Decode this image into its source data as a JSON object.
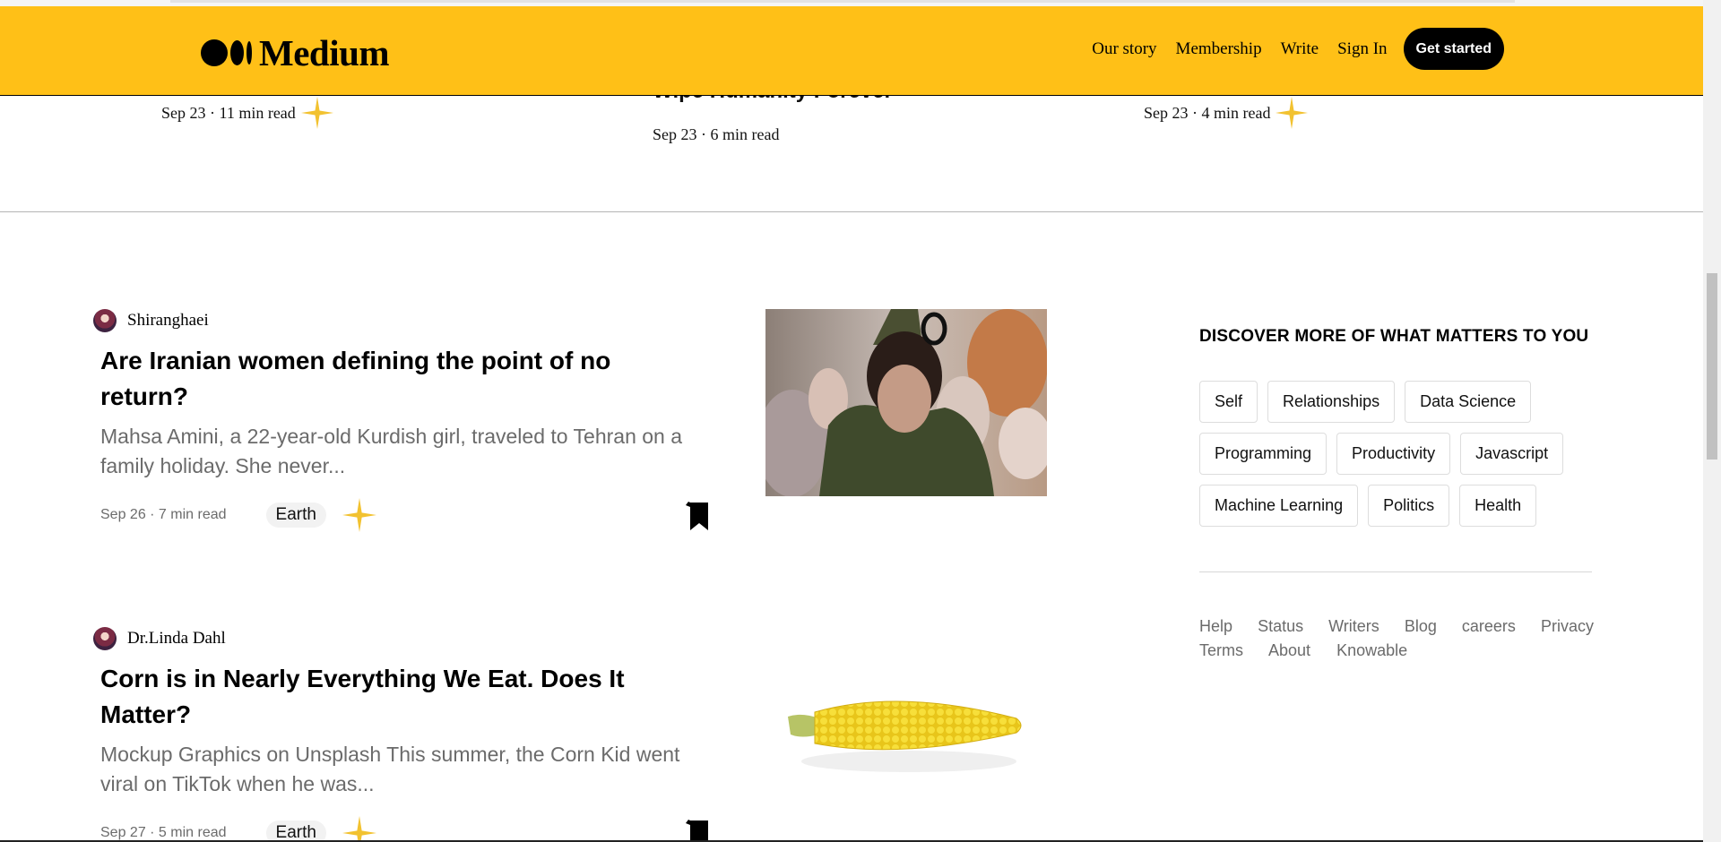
{
  "header": {
    "logo_text": "Medium",
    "nav": [
      "Our story",
      "Membership",
      "Write",
      "Sign In"
    ],
    "cta": "Get started"
  },
  "trending_partial": [
    {
      "meta": "Sep 23 · 11 min read"
    },
    {
      "title_fragment": "Wipe Humanity Forever",
      "meta": "Sep 23 · 6 min read"
    },
    {
      "meta": "Sep 23 · 4 min read"
    }
  ],
  "articles": [
    {
      "author": "Shiranghaei",
      "title": "Are Iranian women defining the point of no return?",
      "excerpt": "Mahsa Amini, a 22-year-old Kurdish girl, traveled to Tehran on a family holiday. She never...",
      "meta": "Sep 26 · 7 min read",
      "tag": "Earth"
    },
    {
      "author": "Dr.Linda Dahl",
      "title": "Corn is in Nearly Everything We Eat. Does It Matter?",
      "excerpt": "Mockup Graphics on Unsplash This summer, the Corn Kid went viral on TikTok when he was...",
      "meta": "Sep 27 · 5 min read",
      "tag": "Earth"
    }
  ],
  "sidebar": {
    "discover_title": "DISCOVER MORE OF WHAT MATTERS TO YOU",
    "topics": [
      [
        "Self",
        "Relationships",
        "Data Science"
      ],
      [
        "Programming",
        "Productivity",
        "Javascript"
      ],
      [
        "Machine Learning",
        "Politics",
        "Health"
      ]
    ],
    "footer_row1": [
      "Help",
      "Status",
      "Writers",
      "Blog",
      "careers",
      "Privacy"
    ],
    "footer_row2": [
      "Terms",
      "About",
      "Knowable"
    ]
  },
  "colors": {
    "brand_yellow": "#ffc017",
    "sparkle": "#f2c230",
    "muted_text": "#6b6b6b"
  },
  "icons": {
    "sparkle": "sparkle-icon",
    "bookmark": "bookmark-icon",
    "logo": "medium-logo-icon"
  }
}
